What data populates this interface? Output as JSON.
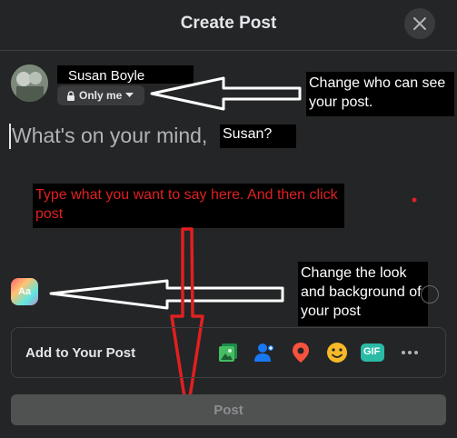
{
  "dialog": {
    "title": "Create Post"
  },
  "author": {
    "name": "Susan Boyle",
    "privacy": "Only me"
  },
  "composer": {
    "placeholder": "What's on your mind,",
    "name_patch": "Susan?"
  },
  "annotations": {
    "privacy_note": "Change who can see your post.",
    "type_note": "Type what you want to say here. And then click post",
    "background_note": "Change the look and background of your post"
  },
  "background_button": {
    "label": "Aa"
  },
  "add_to_post": {
    "label": "Add to Your Post",
    "icons": [
      "photo-video-icon",
      "tag-people-icon",
      "location-pin-icon",
      "feeling-emoji-icon",
      "gif-icon",
      "more-icon"
    ],
    "gif_label": "GIF"
  },
  "post_button": {
    "label": "Post"
  },
  "colors": {
    "background": "#242526",
    "annotation_red": "#e02020",
    "arrow_red": "#e02020"
  }
}
